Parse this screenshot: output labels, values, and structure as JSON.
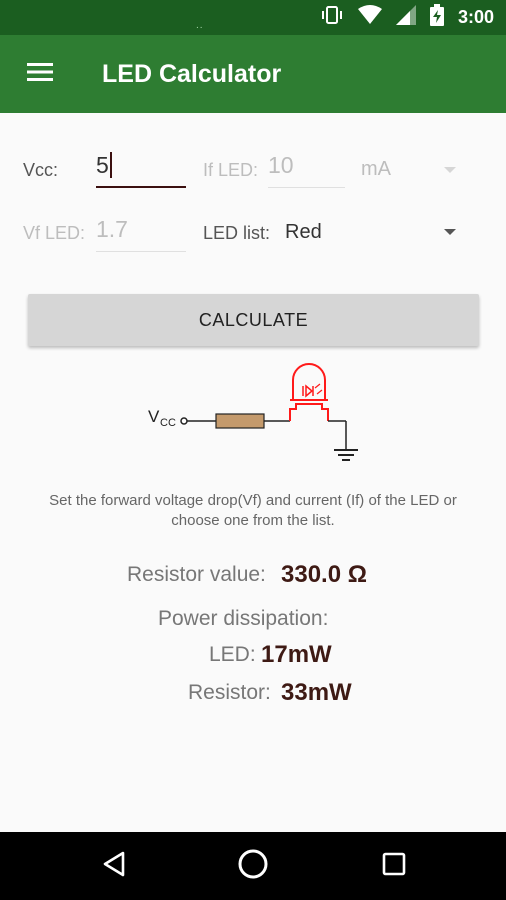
{
  "status_bar": {
    "time": "3:00",
    "notification_dots": "..",
    "icons": [
      "vibrate-icon",
      "wifi-icon",
      "signal-icon",
      "battery-charging-icon"
    ]
  },
  "app_bar": {
    "title": "LED Calculator",
    "menu_icon": "hamburger-menu-icon",
    "color": "#2e7d32"
  },
  "form": {
    "vcc": {
      "label": "Vcc:",
      "value": "5"
    },
    "if_led": {
      "label": "If LED:",
      "value": "10",
      "unit": "mA"
    },
    "vf_led": {
      "label": "Vf LED:",
      "value": "1.7"
    },
    "led_list": {
      "label": "LED list:",
      "selected": "Red"
    }
  },
  "calculate_button": {
    "label": "CALCULATE"
  },
  "circuit": {
    "source_label": "V",
    "source_subscript": "CC",
    "led_color": "#ff1a1a",
    "resistor_color": "#c49a6c"
  },
  "hint": "Set the forward voltage drop(Vf) and current (If) of the LED or choose one from the list.",
  "results": {
    "resistor_label": "Resistor value:",
    "resistor_value": "330.0 Ω",
    "power_title": "Power dissipation:",
    "led_label": "LED:",
    "led_power": "17mW",
    "resistor_power_label": "Resistor:",
    "resistor_power": "33mW"
  },
  "nav_bar": {
    "buttons": [
      "back-icon",
      "home-icon",
      "recents-icon"
    ]
  }
}
